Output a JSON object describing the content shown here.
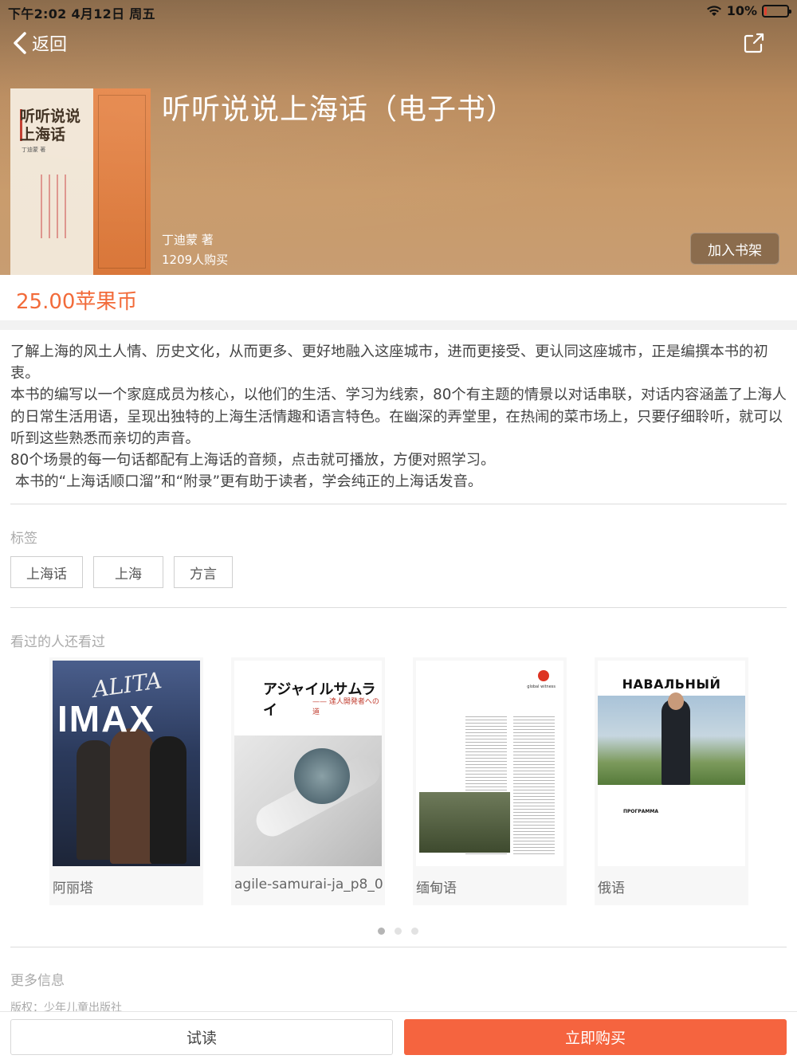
{
  "status_bar": {
    "time_date": "下午2:02   4月12日 周五",
    "battery_text": "10%",
    "battery_level": 0.1,
    "battery_color": "#e0402f"
  },
  "nav": {
    "back_label": "返回",
    "back_icon": "chevron-left-icon",
    "share_icon": "share-icon"
  },
  "cover": {
    "title_line1": "听听说说",
    "title_line2": "上海话",
    "author_small": "丁迪蒙 著"
  },
  "book": {
    "title": "听听说说上海话（电子书）",
    "author": "丁迪蒙  著",
    "buyers": "1209人购买",
    "shelf_button": "加入书架",
    "price": "25.00苹果币"
  },
  "description": [
    "了解上海的风土人情、历史文化，从而更多、更好地融入这座城市，进而更接受、更认同这座城市，正是编撰本书的初衷。",
    "本书的编写以一个家庭成员为核心，以他们的生活、学习为线索，80个有主题的情景以对话串联，对话内容涵盖了上海人的日常生活用语，呈现出独特的上海生活情趣和语言特色。在幽深的弄堂里，在热闹的菜市场上，只要仔细聆听，就可以听到这些熟悉而亲切的声音。",
    "80个场景的每一句话都配有上海话的音频，点击就可播放，方便对照学习。",
    " 本书的“上海话顺口溜”和“附录”更有助于读者，学会纯正的上海话发音。"
  ],
  "tags": {
    "label": "标签",
    "items": [
      "上海话",
      "上海",
      "方言"
    ]
  },
  "related": {
    "label": "看过的人还看过",
    "items": [
      {
        "label": "阿丽塔",
        "poster_title": "ALITA",
        "poster_text": "IMAX"
      },
      {
        "label": "agile-samurai-ja_p8_0",
        "poster_title": "アジャイルサムライ",
        "poster_sub": "—— 達人開発者への道"
      },
      {
        "label": "缅甸语",
        "poster_brand": "global witness"
      },
      {
        "label": "俄语",
        "poster_title": "НАВАЛЬНЫЙ",
        "poster_sub": "ПРОГРАММА"
      }
    ],
    "pages": 3,
    "active_page": 0
  },
  "more_info": {
    "label": "更多信息",
    "copyright": "版权：少年儿童出版社"
  },
  "actions": {
    "try_label": "试读",
    "buy_label": "立即购买"
  },
  "colors": {
    "accent": "#f5643f",
    "price": "#f26b3a"
  }
}
